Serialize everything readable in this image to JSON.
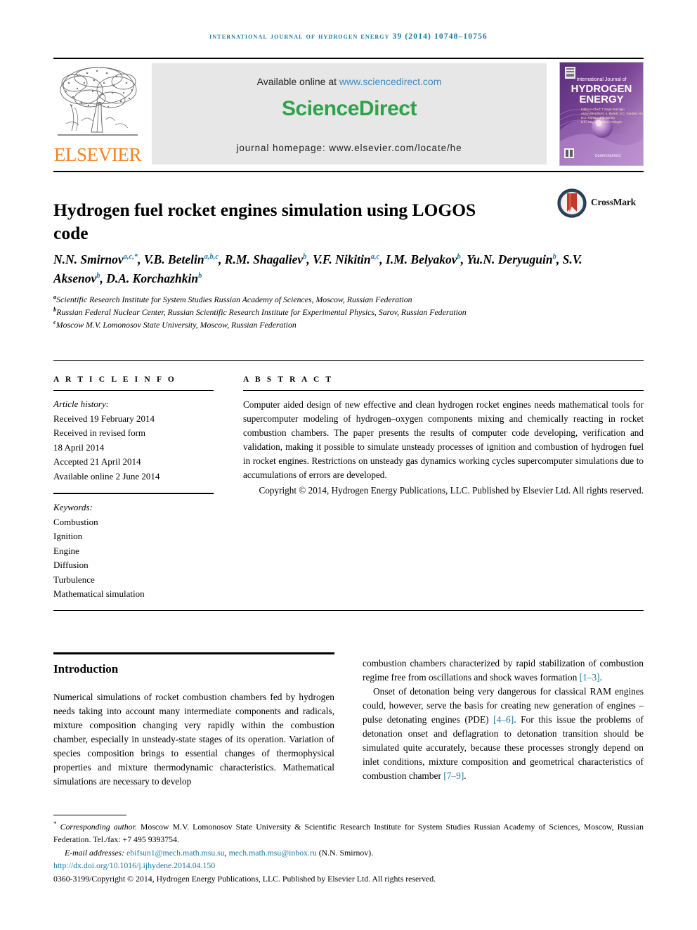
{
  "running_head": "International Journal of Hydrogen Energy 39 (2014) 10748–10756",
  "masthead": {
    "publisher_name": "ELSEVIER",
    "available_prefix": "Available online at ",
    "available_url": "www.sciencedirect.com",
    "brand": "ScienceDirect",
    "homepage": "journal homepage: www.elsevier.com/locate/he",
    "cover": {
      "kicker": "International Journal of",
      "line1": "HYDROGEN",
      "line2": "ENERGY",
      "footer": "ScienceDirect"
    }
  },
  "article": {
    "title": "Hydrogen fuel rocket engines simulation using LOGOS code",
    "crossmark_label": "CrossMark",
    "authors_line1": "N.N. Smirnov",
    "authors": [
      {
        "name": "N.N. Smirnov",
        "sup": "a,c,*"
      },
      {
        "name": "V.B. Betelin",
        "sup": "a,b,c"
      },
      {
        "name": "R.M. Shagaliev",
        "sup": "b"
      },
      {
        "name": "V.F. Nikitin",
        "sup": "a,c"
      },
      {
        "name": "I.M. Belyakov",
        "sup": "b"
      },
      {
        "name": "Yu.N. Deryuguin",
        "sup": "b"
      },
      {
        "name": "S.V. Aksenov",
        "sup": "b"
      },
      {
        "name": "D.A. Korchazhkin",
        "sup": "b"
      }
    ],
    "affiliations": [
      {
        "mark": "a",
        "text": "Scientific Research Institute for System Studies Russian Academy of Sciences, Moscow, Russian Federation"
      },
      {
        "mark": "b",
        "text": "Russian Federal Nuclear Center, Russian Scientific Research Institute for Experimental Physics, Sarov, Russian Federation"
      },
      {
        "mark": "c",
        "text": "Moscow M.V. Lomonosov State University, Moscow, Russian Federation"
      }
    ]
  },
  "article_info": {
    "label": "A R T I C L E   I N F O",
    "history_title": "Article history:",
    "history": [
      "Received 19 February 2014",
      "Received in revised form",
      "18 April 2014",
      "Accepted 21 April 2014",
      "Available online 2 June 2014"
    ],
    "keywords_title": "Keywords:",
    "keywords": [
      "Combustion",
      "Ignition",
      "Engine",
      "Diffusion",
      "Turbulence",
      "Mathematical simulation"
    ]
  },
  "abstract": {
    "label": "A B S T R A C T",
    "body": "Computer aided design of new effective and clean hydrogen rocket engines needs mathematical tools for supercomputer modeling of hydrogen–oxygen components mixing and chemically reacting in rocket combustion chambers. The paper presents the results of computer code developing, verification and validation, making it possible to simulate unsteady processes of ignition and combustion of hydrogen fuel in rocket engines. Restrictions on unsteady gas dynamics working cycles supercomputer simulations due to accumulations of errors are developed.",
    "copyright": "Copyright © 2014, Hydrogen Energy Publications, LLC. Published by Elsevier Ltd. All rights reserved."
  },
  "body": {
    "section_heading": "Introduction",
    "left_paragraph": "Numerical simulations of rocket combustion chambers fed by hydrogen needs taking into account many intermediate components and radicals, mixture composition changing very rapidly within the combustion chamber, especially in unsteady-state stages of its operation. Variation of species composition brings to essential changes of thermophysical properties and mixture thermodynamic characteristics. Mathematical simulations are necessary to develop",
    "right_paragraph_1_pre": "combustion chambers characterized by rapid stabilization of combustion regime free from oscillations and shock waves formation ",
    "right_paragraph_1_cite": "[1–3]",
    "right_paragraph_1_post": ".",
    "right_paragraph_2_a": "Onset of detonation being very dangerous for classical RAM engines could, however, serve the basis for creating new generation of engines – pulse detonating engines (PDE) ",
    "right_paragraph_2_cite1": "[4–6]",
    "right_paragraph_2_b": ". For this issue the problems of detonation onset and deflagration to detonation transition should be simulated quite accurately, because these processes strongly depend on inlet conditions, mixture composition and geometrical characteristics of combustion chamber ",
    "right_paragraph_2_cite2": "[7–9]",
    "right_paragraph_2_c": "."
  },
  "footnotes": {
    "corresponding_marker": "*",
    "corresponding_label": "Corresponding author.",
    "corresponding_text": " Moscow M.V. Lomonosov State University & Scientific Research Institute for System Studies Russian Academy of Sciences, Moscow, Russian Federation. Tel./fax: +7 495 9393754.",
    "email_label": "E-mail addresses:",
    "email_1": "ebifsun1@mech.math.msu.su",
    "email_sep": ", ",
    "email_2": "mech.math.msu@inbox.ru",
    "email_attrib": " (N.N. Smirnov).",
    "doi": "http://dx.doi.org/10.1016/j.ijhydene.2014.04.150",
    "issn_line": "0360-3199/Copyright © 2014, Hydrogen Energy Publications, LLC. Published by Elsevier Ltd. All rights reserved."
  },
  "colors": {
    "link_blue": "#1a7aa8",
    "sciencedirect_green": "#30a14c",
    "elsevier_orange": "#f58220",
    "panel_gray": "#e7e7e7"
  }
}
